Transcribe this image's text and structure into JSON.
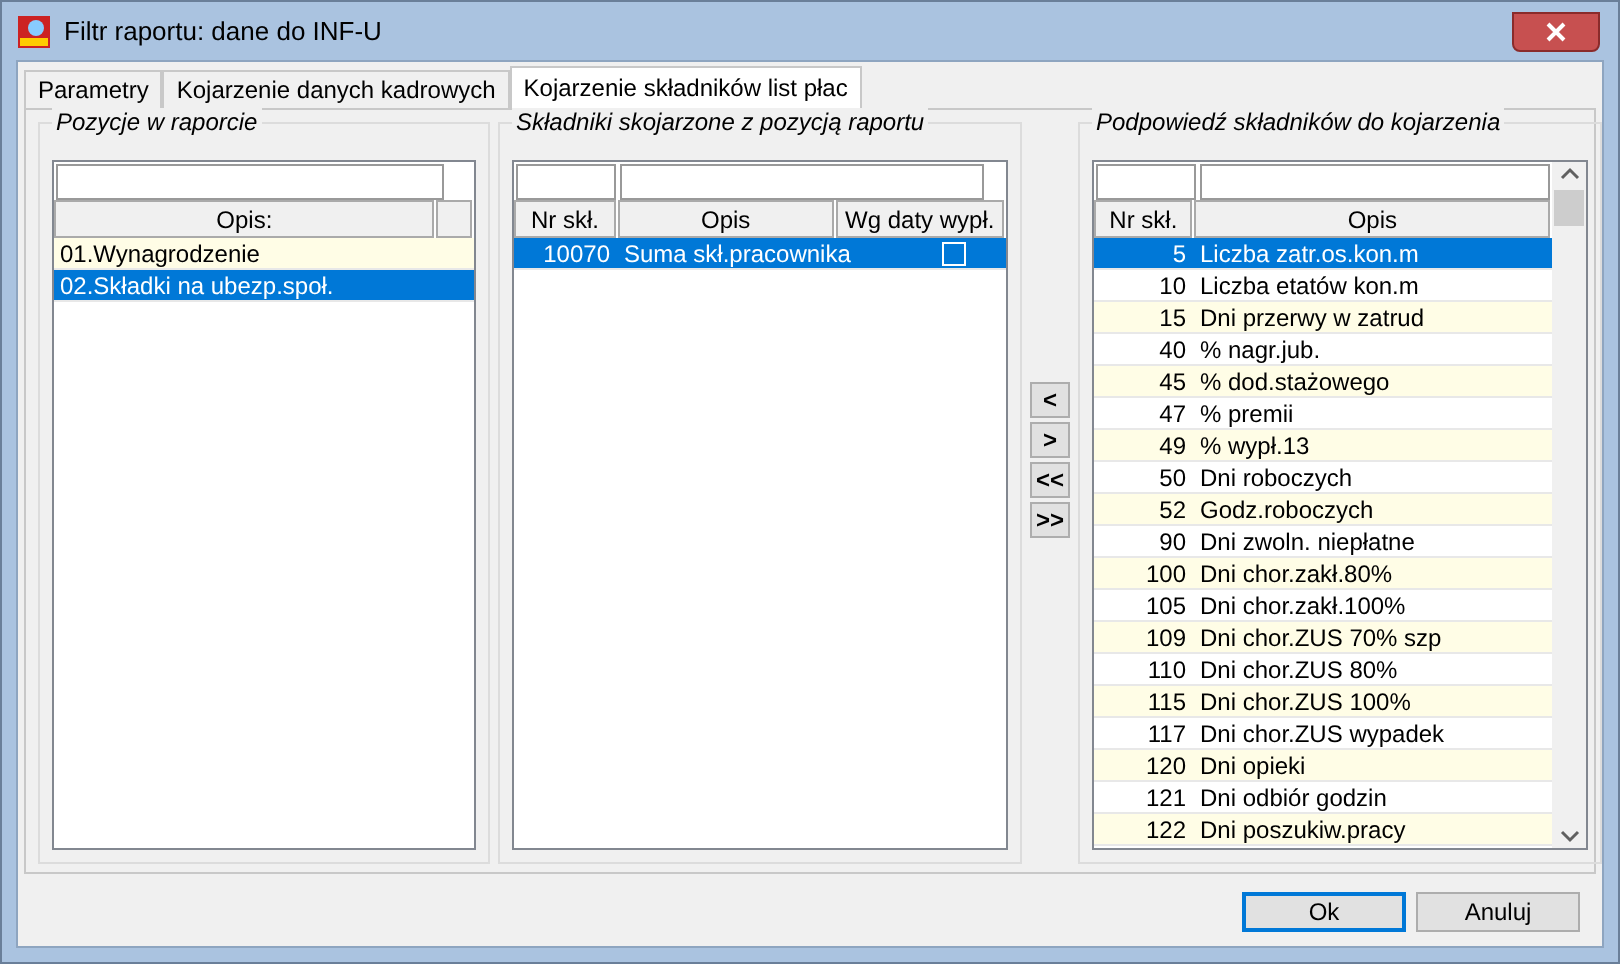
{
  "window": {
    "title": "Filtr raportu: dane do INF-U"
  },
  "tabs": [
    {
      "label": "Parametry",
      "selected": false
    },
    {
      "label": "Kojarzenie danych kadrowych",
      "selected": false
    },
    {
      "label": "Kojarzenie składników list płac",
      "selected": true
    }
  ],
  "positions": {
    "title": "Pozycje w raporcie",
    "columns": [
      "Opis:"
    ],
    "rows": [
      {
        "text": "01.Wynagrodzenie",
        "selected": false
      },
      {
        "text": "02.Składki na ubezp.społ.",
        "selected": true
      }
    ]
  },
  "linked": {
    "title": "Składniki skojarzone z pozycją raportu",
    "columns": [
      "Nr skł.",
      "Opis",
      "Wg daty wypł."
    ],
    "rows": [
      {
        "nr": "10070",
        "opis": "Suma skł.pracownika",
        "checked": false,
        "selected": true
      }
    ]
  },
  "move_buttons": [
    "<",
    ">",
    "<<",
    ">>"
  ],
  "suggestions": {
    "title": "Podpowiedź składników do kojarzenia",
    "columns": [
      "Nr skł.",
      "Opis"
    ],
    "rows": [
      {
        "nr": "5",
        "opis": "Liczba zatr.os.kon.m",
        "selected": true
      },
      {
        "nr": "10",
        "opis": "Liczba etatów kon.m",
        "selected": false
      },
      {
        "nr": "15",
        "opis": "Dni przerwy w zatrud",
        "selected": false
      },
      {
        "nr": "40",
        "opis": "% nagr.jub.",
        "selected": false
      },
      {
        "nr": "45",
        "opis": "% dod.stażowego",
        "selected": false
      },
      {
        "nr": "47",
        "opis": "% premii",
        "selected": false
      },
      {
        "nr": "49",
        "opis": "% wypł.13",
        "selected": false
      },
      {
        "nr": "50",
        "opis": "Dni roboczych",
        "selected": false
      },
      {
        "nr": "52",
        "opis": "Godz.roboczych",
        "selected": false
      },
      {
        "nr": "90",
        "opis": "Dni zwoln. niepłatne",
        "selected": false
      },
      {
        "nr": "100",
        "opis": "Dni chor.zakł.80%",
        "selected": false
      },
      {
        "nr": "105",
        "opis": "Dni chor.zakł.100%",
        "selected": false
      },
      {
        "nr": "109",
        "opis": "Dni chor.ZUS 70% szp",
        "selected": false
      },
      {
        "nr": "110",
        "opis": "Dni chor.ZUS 80%",
        "selected": false
      },
      {
        "nr": "115",
        "opis": "Dni chor.ZUS 100%",
        "selected": false
      },
      {
        "nr": "117",
        "opis": "Dni chor.ZUS wypadek",
        "selected": false
      },
      {
        "nr": "120",
        "opis": "Dni opieki",
        "selected": false
      },
      {
        "nr": "121",
        "opis": "Dni odbiór godzin",
        "selected": false
      },
      {
        "nr": "122",
        "opis": "Dni poszukiw.pracy",
        "selected": false
      }
    ]
  },
  "buttons": [
    {
      "label": "Ok",
      "default": true
    },
    {
      "label": "Anuluj",
      "default": false
    }
  ]
}
